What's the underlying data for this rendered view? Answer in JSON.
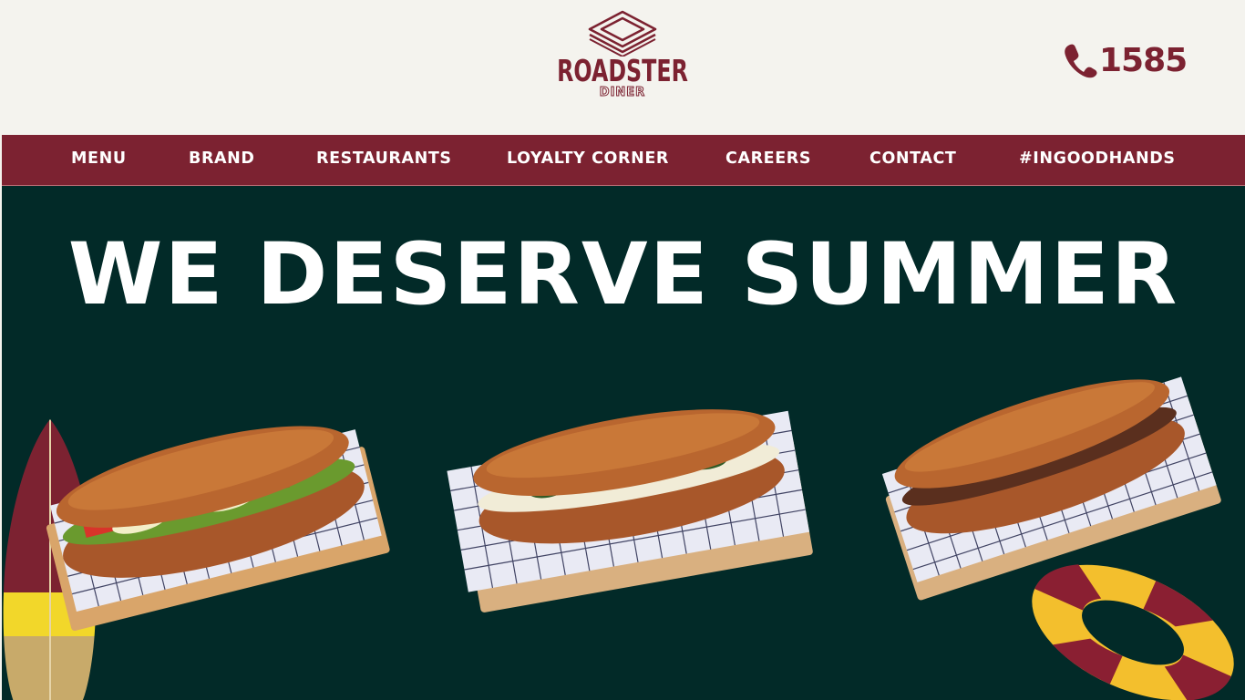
{
  "header": {
    "logo": {
      "name": "ROADSTER",
      "subtitle": "DINER",
      "icon": "stacked-diamond-logo-icon"
    },
    "phone": {
      "icon": "phone-icon",
      "number": "1585"
    }
  },
  "nav": {
    "items": [
      {
        "label": "MENU"
      },
      {
        "label": "BRAND"
      },
      {
        "label": "RESTAURANTS"
      },
      {
        "label": "LOYALTY CORNER"
      },
      {
        "label": "CAREERS"
      },
      {
        "label": "CONTACT"
      },
      {
        "label": "#INGOODHANDS"
      }
    ]
  },
  "hero": {
    "headline": "WE DESERVE SUMMER",
    "images": [
      {
        "subject": "sandwich-chicken-arugula-tomato"
      },
      {
        "subject": "sandwich-chicken-spinach-cheese"
      },
      {
        "subject": "sandwich-beef-onion-fries"
      }
    ],
    "decorations": [
      "surfboard-icon",
      "swim-ring-icon"
    ]
  },
  "colors": {
    "brand": "#7c2231",
    "background": "#f4f3ee",
    "hero": "#022a28",
    "accent_yellow": "#f3bf2d",
    "nav_text": "#ffffff"
  }
}
